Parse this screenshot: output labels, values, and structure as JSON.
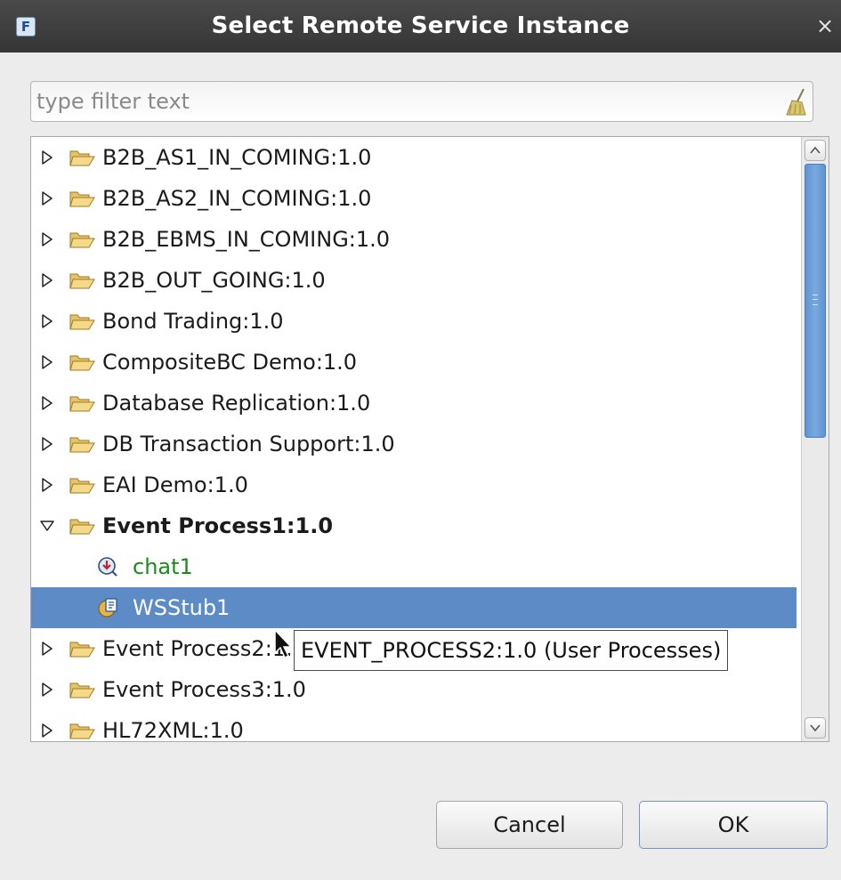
{
  "window": {
    "title": "Select Remote Service Instance",
    "app_icon_glyph": "F",
    "close_glyph": "×"
  },
  "filter": {
    "value": "",
    "placeholder": "type filter text",
    "clear_icon": "broom-clear-icon"
  },
  "tree": {
    "items": [
      {
        "label": "B2B_AS1_IN_COMING:1.0",
        "type": "folder",
        "expanded": false
      },
      {
        "label": "B2B_AS2_IN_COMING:1.0",
        "type": "folder",
        "expanded": false
      },
      {
        "label": "B2B_EBMS_IN_COMING:1.0",
        "type": "folder",
        "expanded": false
      },
      {
        "label": "B2B_OUT_GOING:1.0",
        "type": "folder",
        "expanded": false
      },
      {
        "label": "Bond Trading:1.0",
        "type": "folder",
        "expanded": false
      },
      {
        "label": "CompositeBC Demo:1.0",
        "type": "folder",
        "expanded": false
      },
      {
        "label": "Database Replication:1.0",
        "type": "folder",
        "expanded": false
      },
      {
        "label": "DB Transaction Support:1.0",
        "type": "folder",
        "expanded": false
      },
      {
        "label": "EAI Demo:1.0",
        "type": "folder",
        "expanded": false
      },
      {
        "label": "Event Process1:1.0",
        "type": "folder",
        "expanded": true
      },
      {
        "label": "chat1",
        "type": "service",
        "icon": "chat-service-icon"
      },
      {
        "label": "WSStub1",
        "type": "service",
        "icon": "wsstub-service-icon",
        "selected": true
      },
      {
        "label": "Event Process2:1.0",
        "type": "folder",
        "expanded": false
      },
      {
        "label": "Event Process3:1.0",
        "type": "folder",
        "expanded": false
      },
      {
        "label": "HL72XML:1.0",
        "type": "folder",
        "expanded": false
      }
    ]
  },
  "tooltip": {
    "text": "EVENT_PROCESS2:1.0 (User Processes)"
  },
  "buttons": {
    "cancel": "Cancel",
    "ok": "OK"
  },
  "colors": {
    "selection": "#5c8bc5",
    "service_text_green": "#1b8a1b",
    "titlebar": "#3d3d3d",
    "scroll_thumb": "#6a9ad6"
  }
}
